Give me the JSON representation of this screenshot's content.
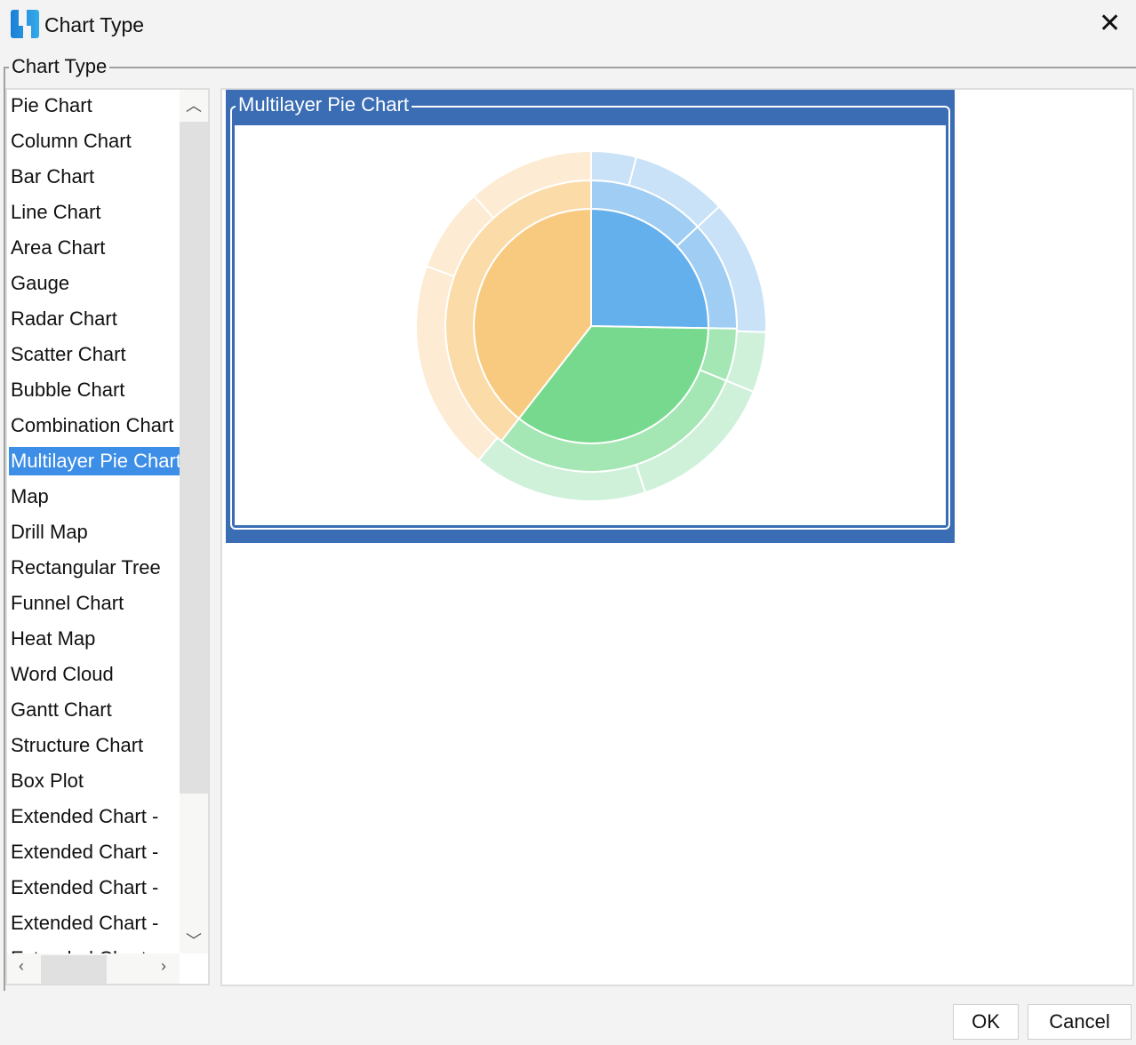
{
  "window": {
    "title": "Chart Type",
    "icon": "app-logo-icon",
    "close_icon": "close-icon"
  },
  "group": {
    "label": "Chart Type"
  },
  "chart_types": [
    "Pie Chart",
    "Column Chart",
    "Bar Chart",
    "Line Chart",
    "Area Chart",
    "Gauge",
    "Radar Chart",
    "Scatter Chart",
    "Bubble Chart",
    "Combination Chart",
    "Multilayer Pie Chart",
    "Map",
    "Drill Map",
    "Rectangular Tree",
    "Funnel Chart",
    "Heat Map",
    "Word Cloud",
    "Gantt Chart",
    "Structure Chart",
    "Box Plot",
    "Extended Chart - ",
    "Extended Chart - ",
    "Extended Chart - ",
    "Extended Chart - ",
    "Extended Chart - "
  ],
  "selected_index": 10,
  "preview": {
    "label": "Multilayer Pie Chart",
    "chart_data": {
      "type": "pie",
      "rings": [
        {
          "slices": [
            {
              "from": 0,
              "to": 91,
              "color": "#63b0ec"
            },
            {
              "from": 91,
              "to": 218,
              "color": "#77d98e"
            },
            {
              "from": 218,
              "to": 360,
              "color": "#f8ca80"
            }
          ]
        },
        {
          "slices": [
            {
              "from": 0,
              "to": 47,
              "color": "#9fcdf3"
            },
            {
              "from": 47,
              "to": 91,
              "color": "#9fcdf3"
            },
            {
              "from": 91,
              "to": 112,
              "color": "#a4e6b4"
            },
            {
              "from": 112,
              "to": 218,
              "color": "#a4e6b4"
            },
            {
              "from": 218,
              "to": 360,
              "color": "#fbdba8"
            }
          ]
        },
        {
          "slices": [
            {
              "from": 0,
              "to": 15,
              "color": "#c9e2f8"
            },
            {
              "from": 15,
              "to": 47,
              "color": "#c9e2f8"
            },
            {
              "from": 47,
              "to": 92,
              "color": "#c9e2f8"
            },
            {
              "from": 92,
              "to": 112,
              "color": "#cff1da"
            },
            {
              "from": 112,
              "to": 162,
              "color": "#cff1da"
            },
            {
              "from": 162,
              "to": 220,
              "color": "#cff1da"
            },
            {
              "from": 220,
              "to": 290,
              "color": "#fdebd3"
            },
            {
              "from": 290,
              "to": 318,
              "color": "#fdebd3"
            },
            {
              "from": 318,
              "to": 360,
              "color": "#fdebd3"
            }
          ]
        }
      ]
    }
  },
  "buttons": {
    "ok": "OK",
    "cancel": "Cancel"
  }
}
